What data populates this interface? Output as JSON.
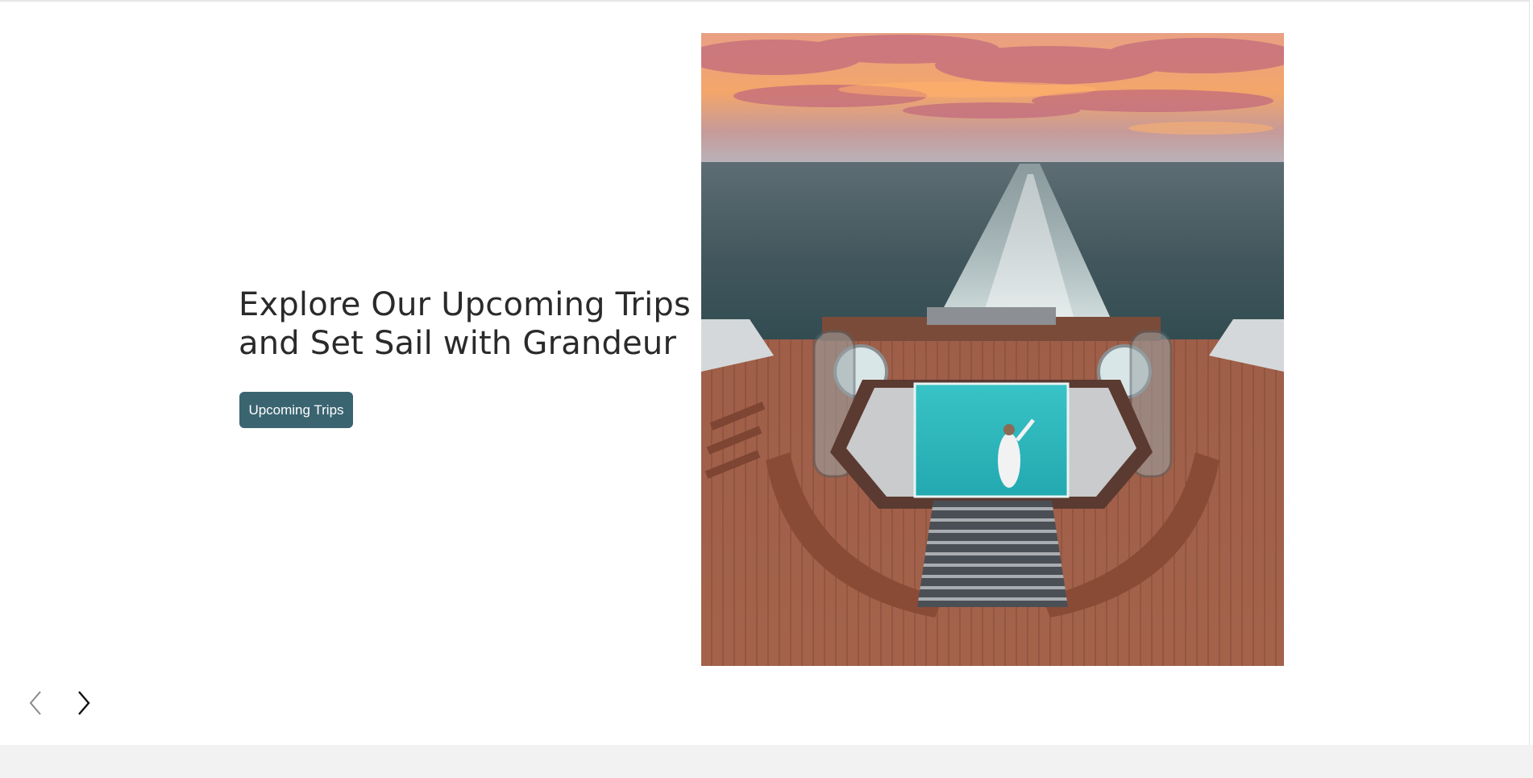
{
  "hero": {
    "headline_line1": "Explore Our Upcoming Trips",
    "headline_line2": "and Set Sail with Grandeur",
    "cta_label": "Upcoming Trips",
    "image_alt": "Cruise ship stern deck with pool overlooking ocean wake at sunset"
  },
  "carousel": {
    "prev_icon": "chevron-left-icon",
    "next_icon": "chevron-right-icon"
  },
  "colors": {
    "cta_background": "#3a6470",
    "headline_text": "#2a2a2a",
    "footer_band": "#f2f2f2"
  }
}
